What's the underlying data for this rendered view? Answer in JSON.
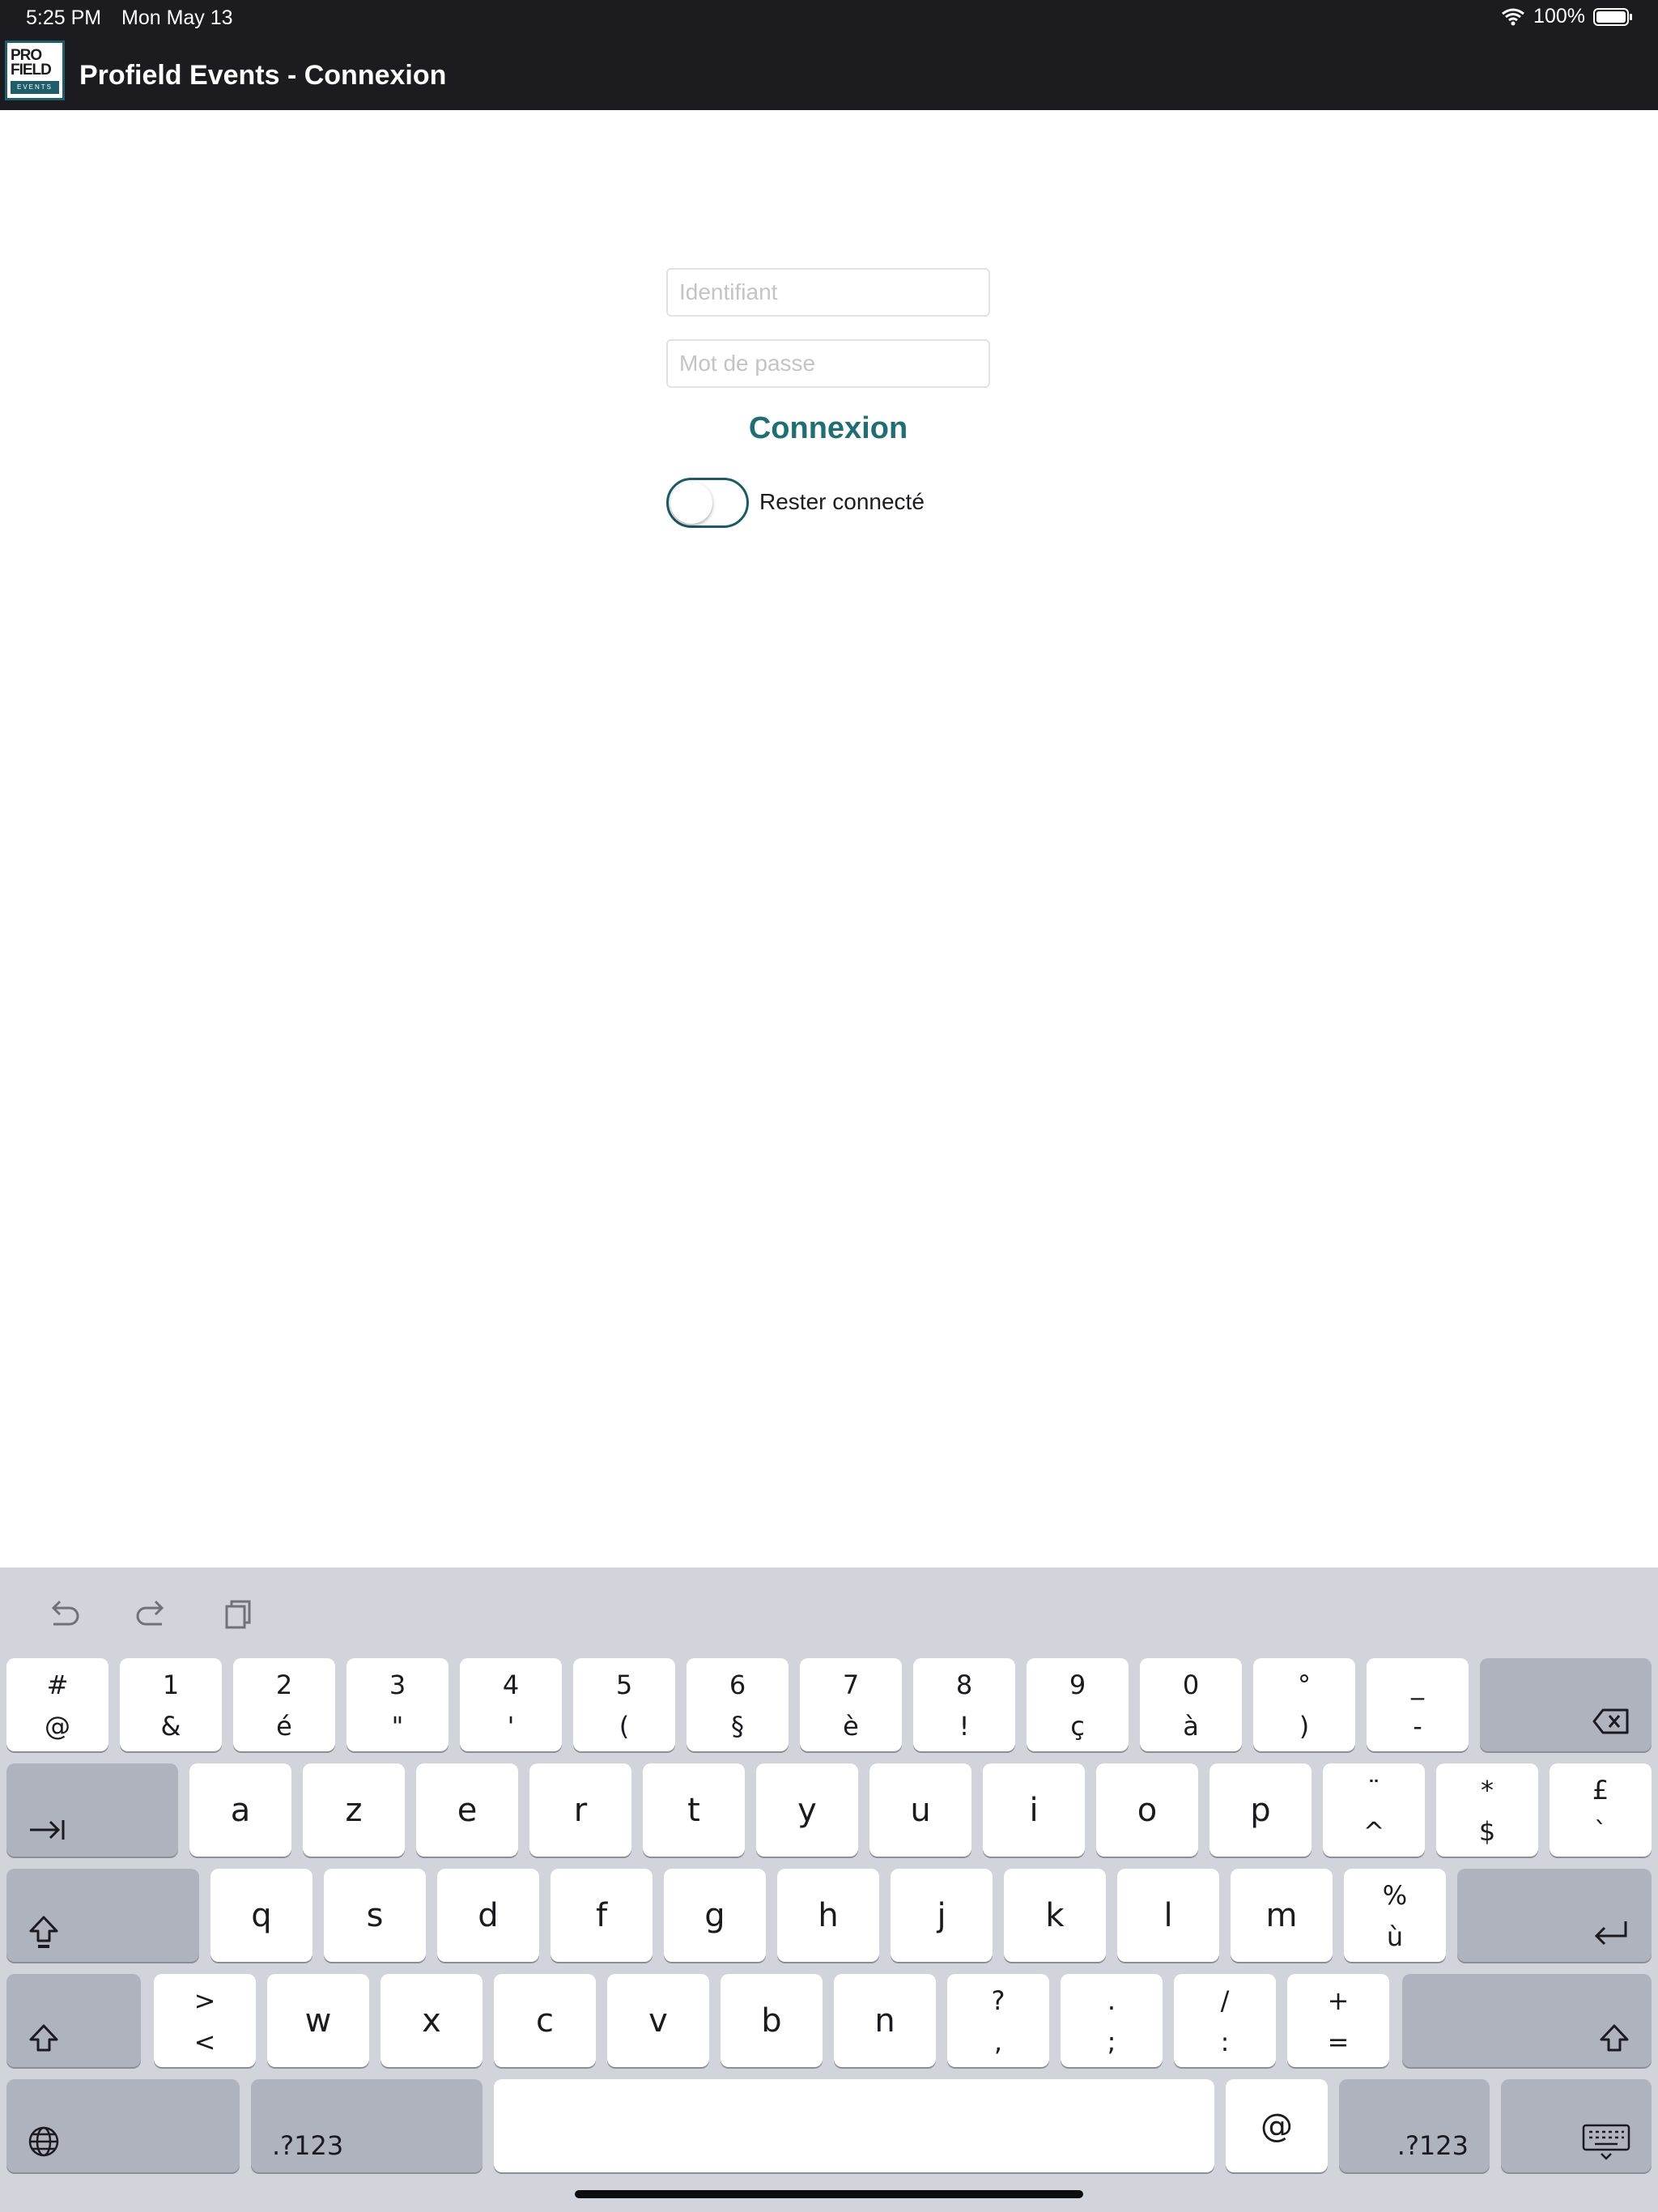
{
  "status": {
    "time": "5:25 PM",
    "date": "Mon May 13",
    "battery": "100%"
  },
  "app": {
    "title": "Profield Events - Connexion",
    "logo_line1": "PRO",
    "logo_line2": "FIELD",
    "logo_line3": "EVENTS"
  },
  "form": {
    "username_placeholder": "Identifiant",
    "password_placeholder": "Mot de passe",
    "login_label": "Connexion",
    "stay_connected_label": "Rester connecté",
    "stay_connected": false,
    "accent": "#1d6f73"
  },
  "keyboard": {
    "toolbar": [
      "undo-icon",
      "redo-icon",
      "paste-icon"
    ],
    "row1": [
      {
        "top": "#",
        "bottom": "@"
      },
      {
        "top": "1",
        "bottom": "&"
      },
      {
        "top": "2",
        "bottom": "é"
      },
      {
        "top": "3",
        "bottom": "\""
      },
      {
        "top": "4",
        "bottom": "'"
      },
      {
        "top": "5",
        "bottom": "("
      },
      {
        "top": "6",
        "bottom": "§"
      },
      {
        "top": "7",
        "bottom": "è"
      },
      {
        "top": "8",
        "bottom": "!"
      },
      {
        "top": "9",
        "bottom": "ç"
      },
      {
        "top": "0",
        "bottom": "à"
      },
      {
        "top": "°",
        "bottom": ")"
      },
      {
        "top": "_",
        "bottom": "-"
      }
    ],
    "row2": [
      "a",
      "z",
      "e",
      "r",
      "t",
      "y",
      "u",
      "i",
      "o",
      "p"
    ],
    "row2_extra": [
      {
        "top": "¨",
        "bottom": "^"
      },
      {
        "top": "*",
        "bottom": "$"
      },
      {
        "top": "£",
        "bottom": "`"
      }
    ],
    "row3": [
      "q",
      "s",
      "d",
      "f",
      "g",
      "h",
      "j",
      "k",
      "l",
      "m"
    ],
    "row3_extra": {
      "top": "%",
      "bottom": "ù"
    },
    "row4_first": {
      "top": ">",
      "bottom": "<"
    },
    "row4": [
      "w",
      "x",
      "c",
      "v",
      "b",
      "n"
    ],
    "row4_extra": [
      {
        "top": "?",
        "bottom": ","
      },
      {
        "top": ".",
        "bottom": ";"
      },
      {
        "top": "/",
        "bottom": ":"
      },
      {
        "top": "+",
        "bottom": "="
      }
    ],
    "numbers_label": ".?123",
    "at_label": "@"
  },
  "colors": {
    "bar": "#1b1b20",
    "keyboard_bg": "#d1d4db",
    "key_dark": "#aeb3be"
  }
}
